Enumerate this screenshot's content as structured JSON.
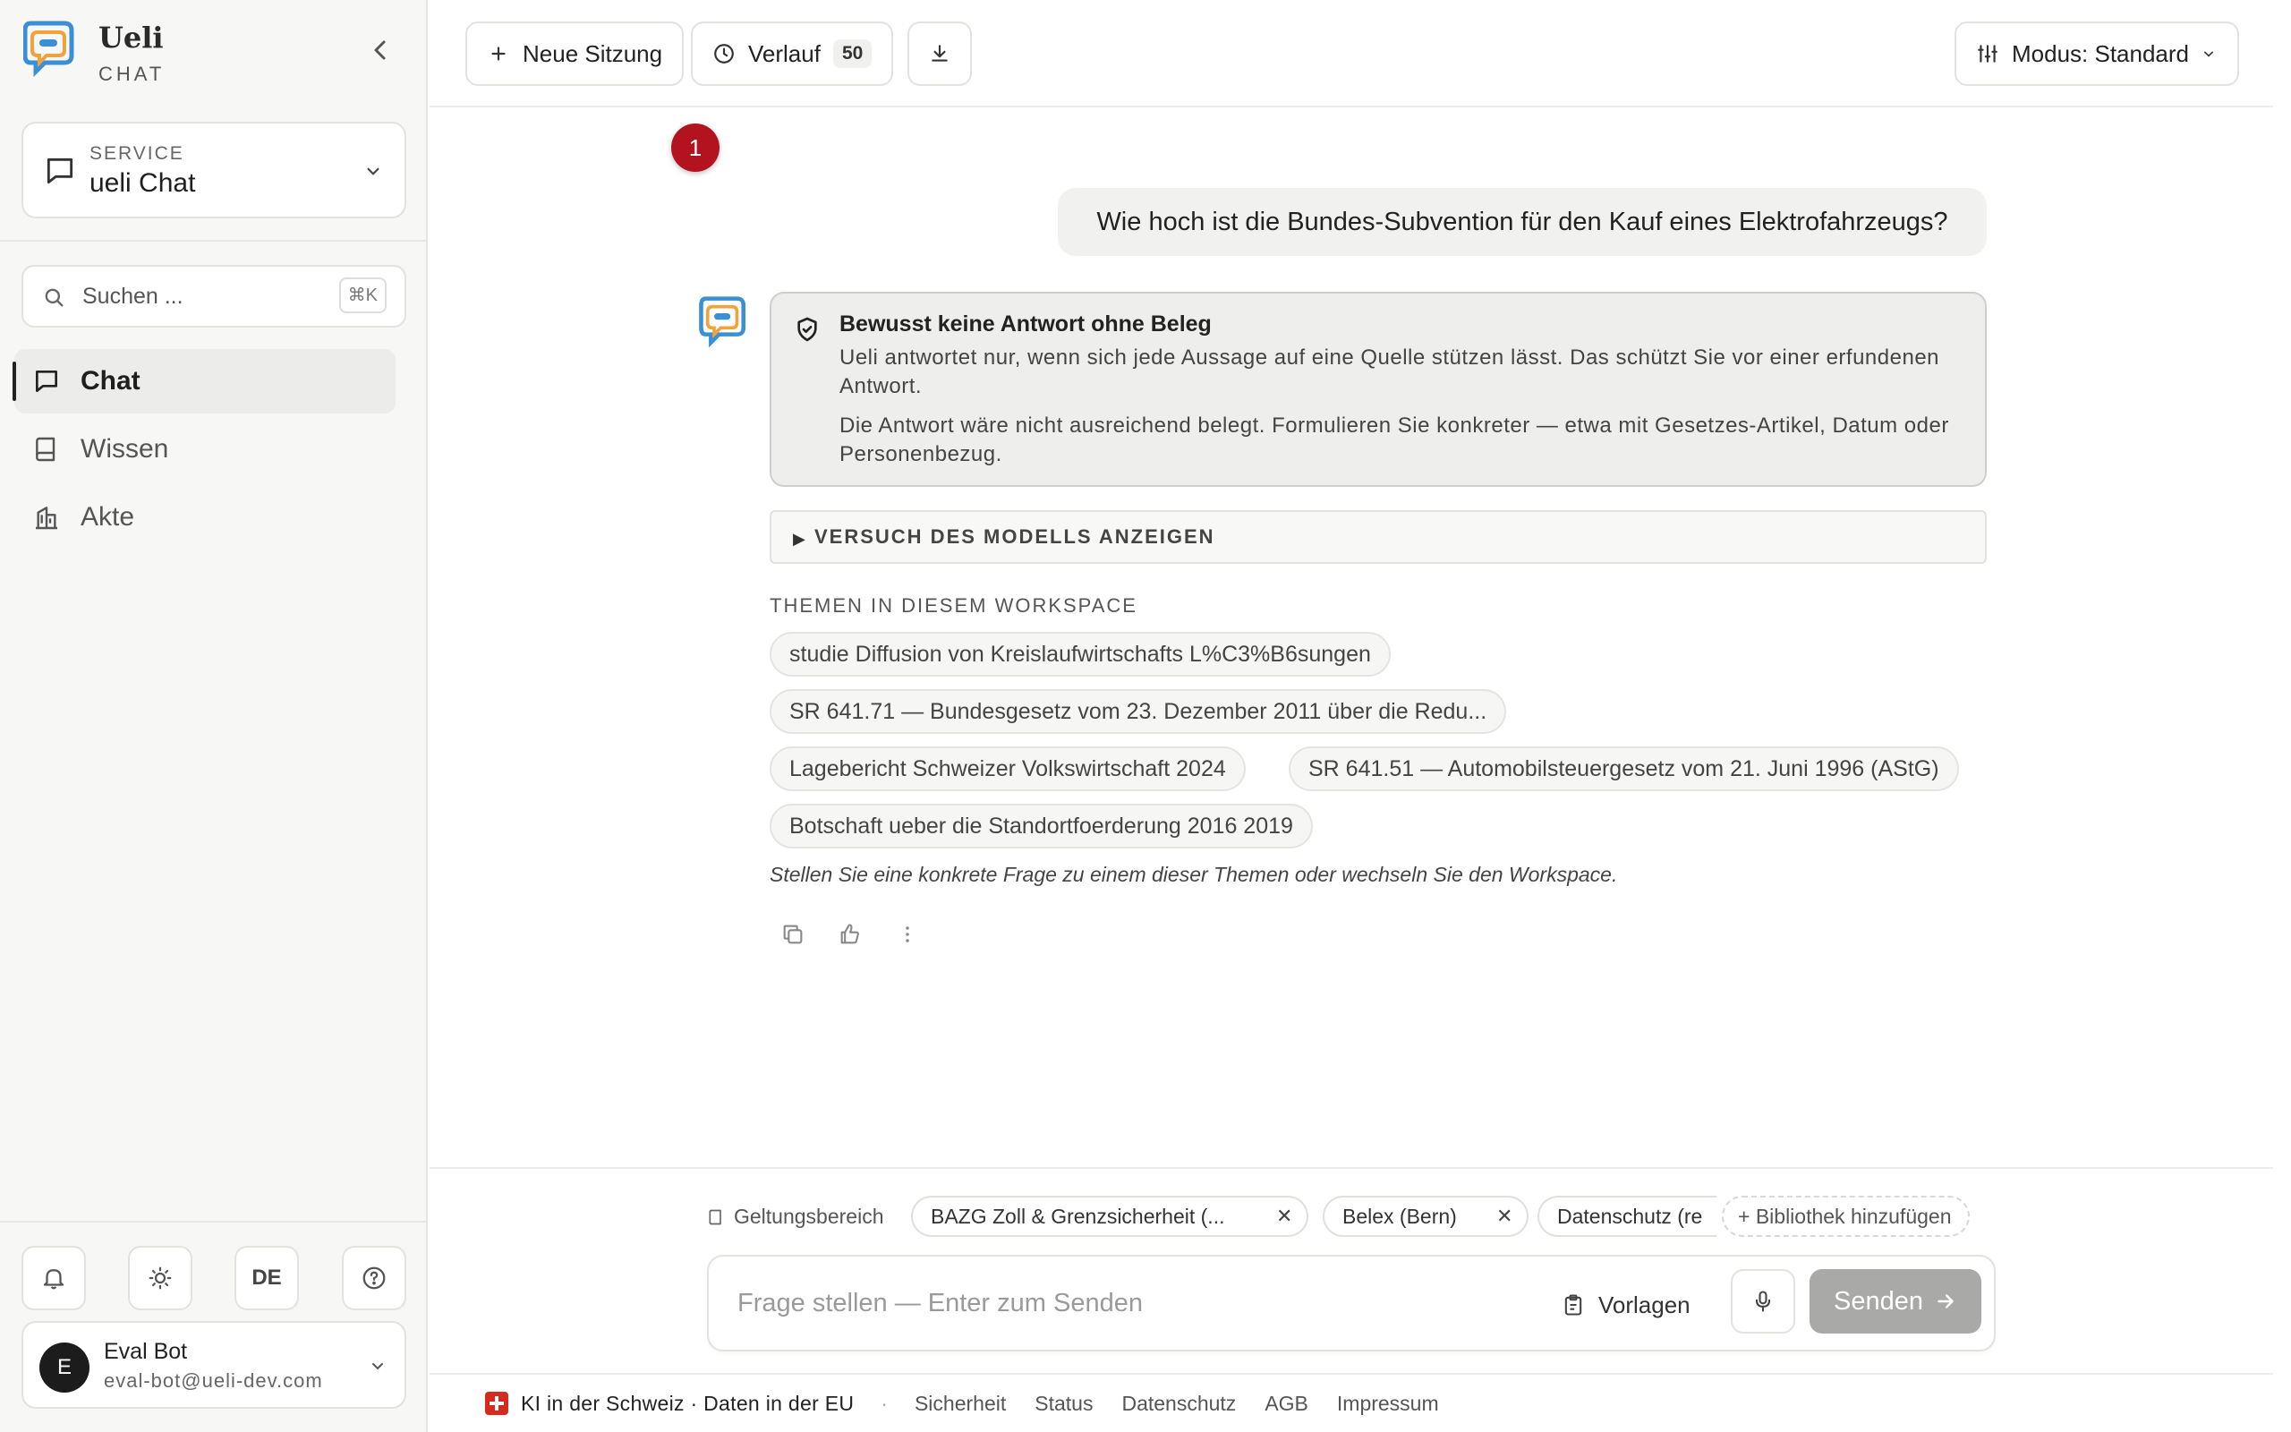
{
  "brand": {
    "name": "Ueli",
    "subtitle": "CHAT"
  },
  "service": {
    "label": "SERVICE",
    "value": "ueli Chat"
  },
  "search": {
    "placeholder": "Suchen ...",
    "shortcut": "⌘K"
  },
  "nav": [
    {
      "label": "Chat",
      "icon": "chat-bubble-icon",
      "active": true
    },
    {
      "label": "Wissen",
      "icon": "book-icon",
      "active": false
    },
    {
      "label": "Akte",
      "icon": "building-icon",
      "active": false
    }
  ],
  "utilities": {
    "language": "DE"
  },
  "user": {
    "initial": "E",
    "name": "Eval Bot",
    "email": "eval-bot@ueli-dev.com"
  },
  "toolbar": {
    "new_session": "Neue Sitzung",
    "history": "Verlauf",
    "history_count": "50",
    "mode": "Modus: Standard"
  },
  "notification_count": "1",
  "conversation": {
    "user_message": "Wie hoch ist die Bundes-Subvention für den Kauf eines Elektrofahrzeugs?",
    "notice": {
      "title": "Bewusst keine Antwort ohne Beleg",
      "paragraph1": "Ueli antwortet nur, wenn sich jede Aussage auf eine Quelle stützen lässt. Das schützt Sie vor einer erfundenen Antwort.",
      "paragraph2": "Die Antwort wäre nicht ausreichend belegt. Formulieren Sie konkreter — etwa mit Gesetzes-Artikel, Datum oder Personenbezug."
    },
    "details_label": "VERSUCH DES MODELLS ANZEIGEN",
    "topics_heading": "THEMEN IN DIESEM WORKSPACE",
    "topics": [
      "studie Diffusion von Kreislaufwirtschafts L%C3%B6sungen",
      "SR 641.71 — Bundesgesetz vom 23. Dezember 2011 über die Redu...",
      "Lagebericht Schweizer Volkswirtschaft 2024",
      "SR 641.51 — Automobilsteuergesetz vom 21. Juni 1996 (AStG)",
      "Botschaft ueber die Standortfoerderung 2016 2019"
    ],
    "topics_hint": "Stellen Sie eine konkrete Frage zu einem dieser Themen oder wechseln Sie den Workspace."
  },
  "composer": {
    "scope_label": "Geltungsbereich",
    "scope_chips": [
      "BAZG Zoll & Grenzsicherheit (...",
      "Belex (Bern)",
      "Datenschutz (re"
    ],
    "add_library": "Bibliothek hinzufügen",
    "placeholder": "Frage stellen — Enter zum Senden",
    "templates": "Vorlagen",
    "send": "Senden"
  },
  "footer": {
    "claim": "KI in der Schweiz · Daten in der EU",
    "separator": "·",
    "links": [
      "Sicherheit",
      "Status",
      "Datenschutz",
      "AGB",
      "Impressum"
    ]
  },
  "colors": {
    "accent_red": "#b3121f",
    "swiss_red": "#d52b1e",
    "send_disabled": "#a9a9a7"
  }
}
